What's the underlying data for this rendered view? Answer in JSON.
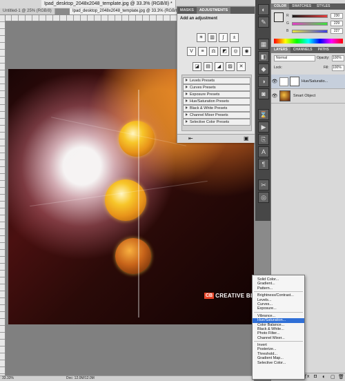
{
  "doc_tabs": [
    {
      "label": "Ipad_desktop_2048x2048_template.jpg @ 33.3% (RGB/8) *",
      "active": true
    }
  ],
  "doc_tabs_row2": [
    {
      "label": "Untitled-1 @ 25% (RGB/8)",
      "active": false
    },
    {
      "label": "Ipad_desktop_2048x2048_template.jpg @ 33.3% (RGB/8)",
      "active": true
    }
  ],
  "adjustments_panel": {
    "tabs": [
      "MASKS",
      "ADJUSTMENTS"
    ],
    "active_tab": "ADJUSTMENTS",
    "title": "Add an adjustment",
    "presets": [
      "Levels Presets",
      "Curves Presets",
      "Exposure Presets",
      "Hue/Saturation Presets",
      "Black & White Presets",
      "Channel Mixer Presets",
      "Selective Color Presets"
    ]
  },
  "color_panel": {
    "tabs": [
      "COLOR",
      "SWATCHES",
      "STYLES"
    ],
    "active_tab": "COLOR",
    "sliders": [
      {
        "label": "R",
        "value": "230",
        "color": "#e63c3c"
      },
      {
        "label": "G",
        "value": "229",
        "color": "#3ce63c"
      },
      {
        "label": "B",
        "value": "227",
        "color": "#3c3ce6"
      }
    ]
  },
  "layers_panel": {
    "tabs": [
      "LAYERS",
      "CHANNELS",
      "PATHS"
    ],
    "active_tab": "LAYERS",
    "blend_mode": "Normal",
    "opacity_label": "Opacity:",
    "opacity_value": "100%",
    "lock_label": "Lock:",
    "fill_label": "Fill:",
    "fill_value": "100%",
    "layers": [
      {
        "name": "Hue/Saturatio..."
      },
      {
        "name": "Smart Object"
      }
    ]
  },
  "adjustment_menu": {
    "items": [
      {
        "label": "Solid Color...",
        "group": 1
      },
      {
        "label": "Gradient...",
        "group": 1
      },
      {
        "label": "Pattern...",
        "group": 1
      },
      {
        "label": "Brightness/Contrast...",
        "group": 2
      },
      {
        "label": "Levels...",
        "group": 2
      },
      {
        "label": "Curves...",
        "group": 2
      },
      {
        "label": "Exposure...",
        "group": 2
      },
      {
        "label": "Vibrance...",
        "group": 3
      },
      {
        "label": "Hue/Saturation...",
        "group": 3,
        "highlight": true
      },
      {
        "label": "Color Balance...",
        "group": 3
      },
      {
        "label": "Black & White...",
        "group": 3
      },
      {
        "label": "Photo Filter...",
        "group": 3
      },
      {
        "label": "Channel Mixer...",
        "group": 3
      },
      {
        "label": "Invert",
        "group": 4
      },
      {
        "label": "Posterize...",
        "group": 4
      },
      {
        "label": "Threshold...",
        "group": 4
      },
      {
        "label": "Gradient Map...",
        "group": 4
      },
      {
        "label": "Selective Color...",
        "group": 4
      }
    ]
  },
  "artwork": {
    "logo_badge": "CB",
    "logo_text": "CREATIVE BLOQ"
  },
  "status_bar": {
    "zoom": "33.33%",
    "doc": "Doc: 12.0M/12.0M"
  },
  "accent_colors": {
    "menu_highlight": "#2f6fd6",
    "logo_red": "#e8462a"
  }
}
